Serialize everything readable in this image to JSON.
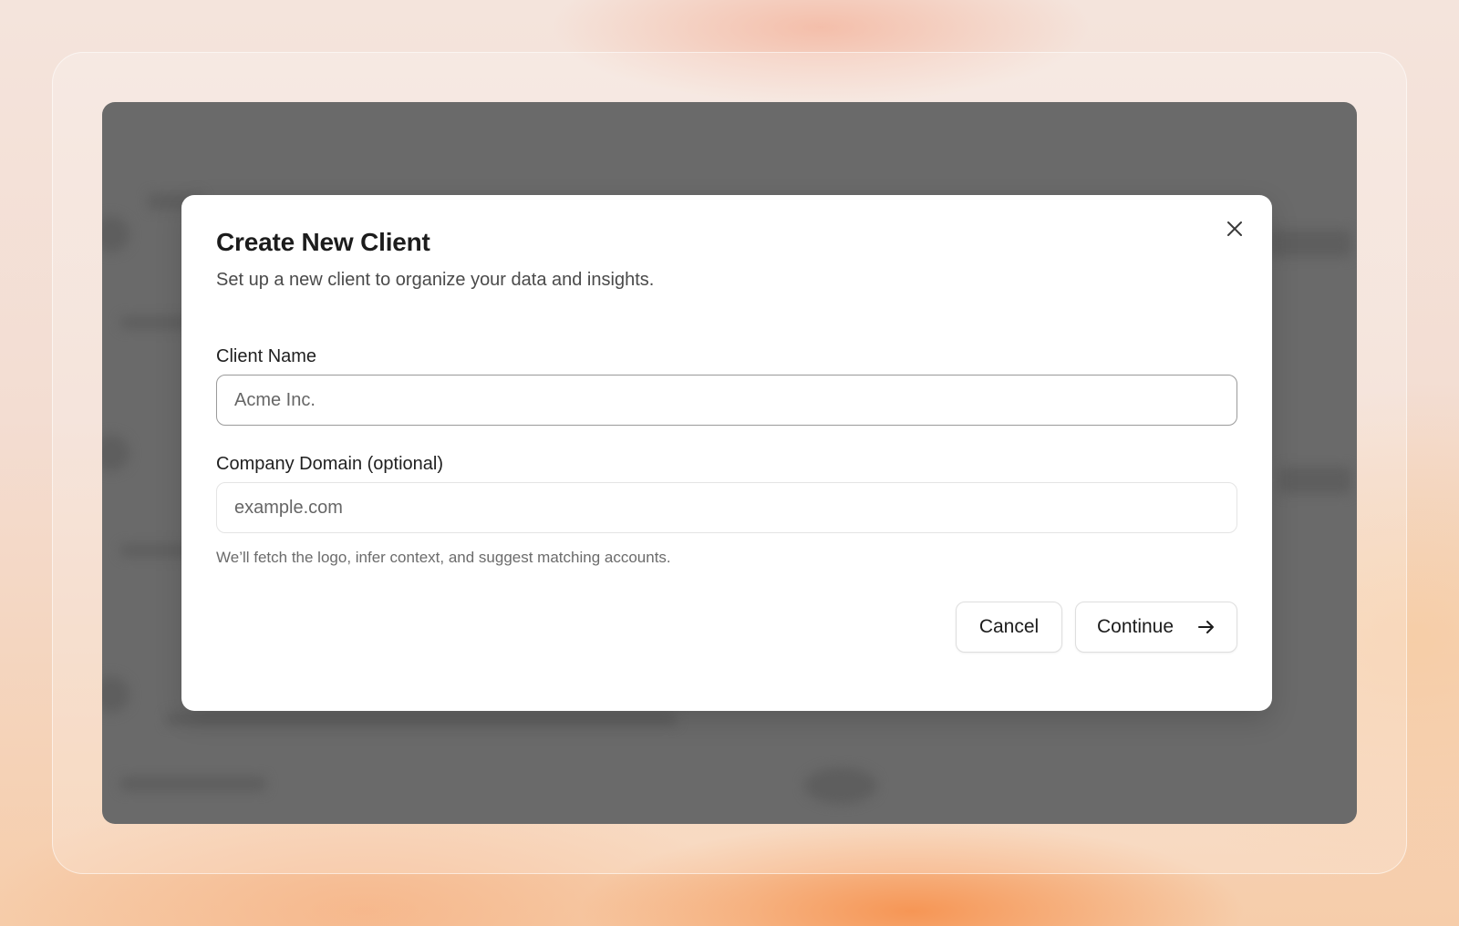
{
  "dialog": {
    "title": "Create New Client",
    "subtitle": "Set up a new client to organize your data and insights.",
    "close_icon": "close-icon",
    "fields": {
      "client_name": {
        "label": "Client Name",
        "value": "",
        "placeholder": "Acme Inc."
      },
      "company_domain": {
        "label": "Company Domain (optional)",
        "value": "",
        "placeholder": "example.com"
      }
    },
    "helper_text": "We’ll fetch the logo, infer context, and suggest matching accounts.",
    "buttons": {
      "cancel_label": "Cancel",
      "continue_label": "Continue",
      "continue_icon": "arrow-right-icon"
    }
  },
  "colors": {
    "overlay": "#6a6a6a",
    "dialog_bg": "#ffffff",
    "text_primary": "#1c1c1c",
    "text_secondary": "#4a4a4a"
  }
}
